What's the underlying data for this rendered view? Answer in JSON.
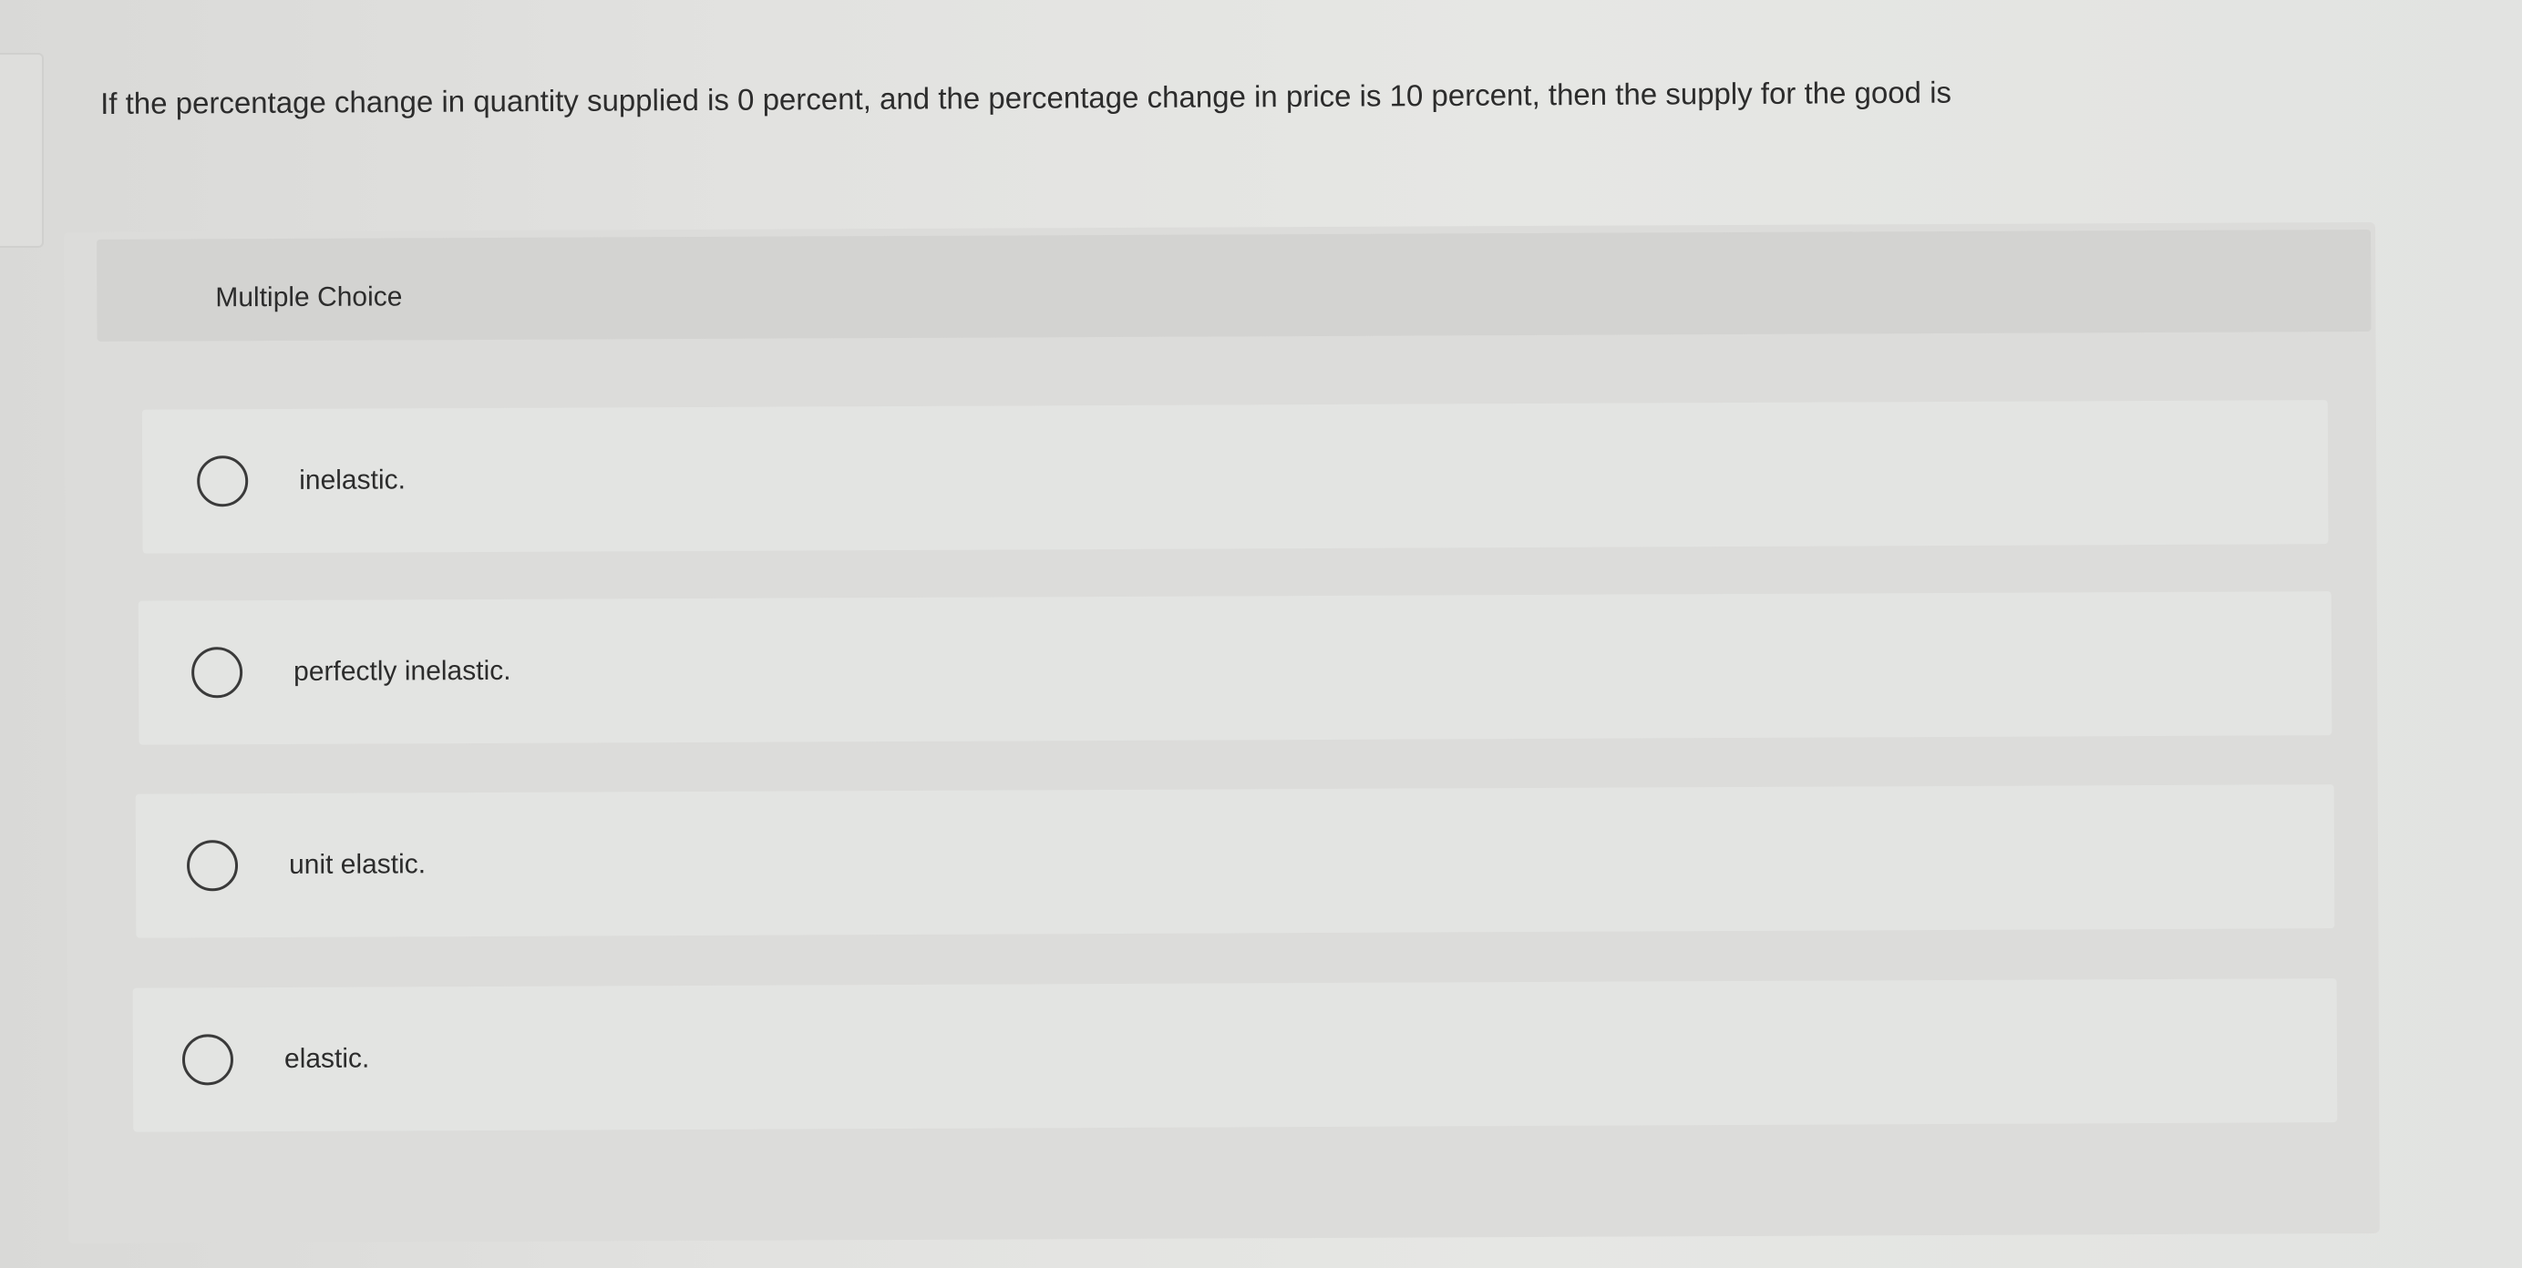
{
  "question": {
    "text": "If the percentage change in quantity supplied is 0 percent, and the percentage change in price is 10 percent, then the supply for the good is"
  },
  "multiple_choice": {
    "header_label": "Multiple Choice",
    "options": [
      {
        "label": "inelastic."
      },
      {
        "label": "perfectly inelastic."
      },
      {
        "label": "unit elastic."
      },
      {
        "label": "elastic."
      }
    ]
  },
  "colors": {
    "background": "#e2e3e1",
    "panel": "#dcdcda",
    "header": "#d3d3d1",
    "option_row": "#e3e4e2",
    "text": "#2c2c2c",
    "radio_border": "#3a3a3a"
  }
}
